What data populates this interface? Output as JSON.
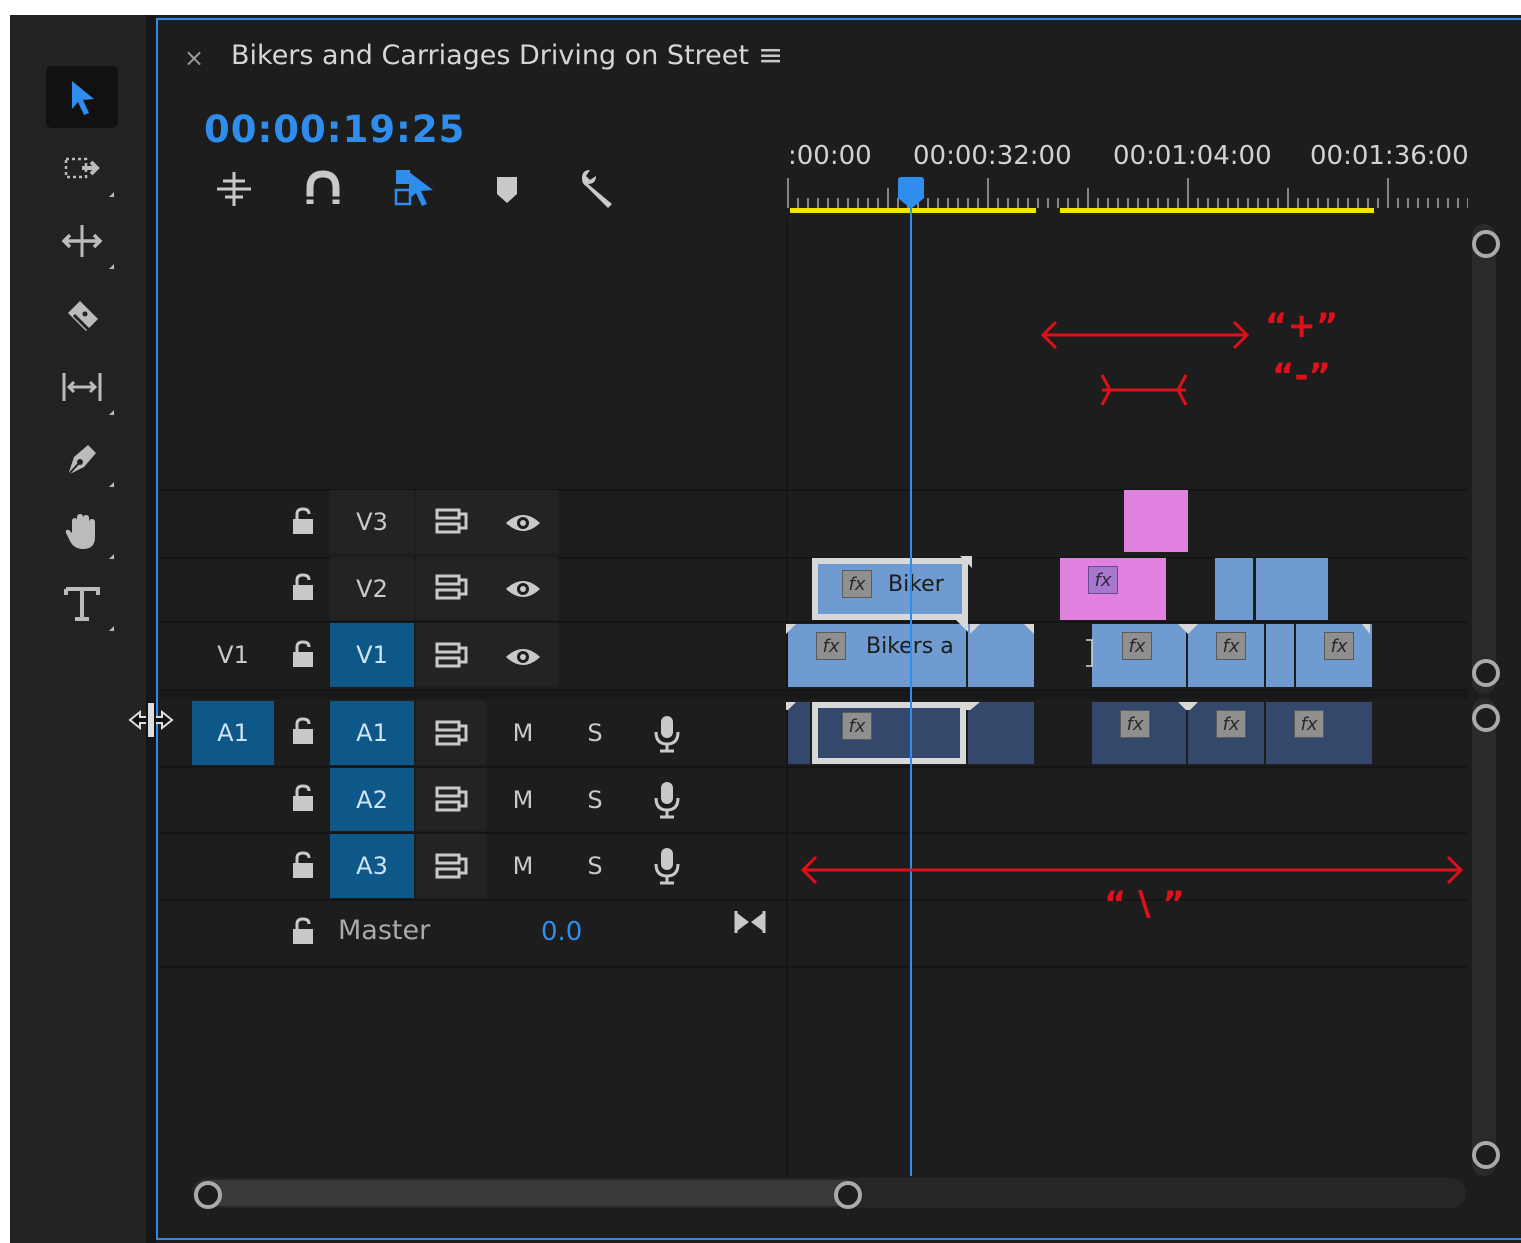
{
  "panel": {
    "close_glyph": "×",
    "sequence_title": "Bikers and Carriages Driving on Street",
    "menu_glyph": "≡"
  },
  "timecode": "00:00:19:25",
  "toolbar": {
    "tools": [
      {
        "name": "selection-tool-icon",
        "active": true
      },
      {
        "name": "track-select-forward-tool-icon",
        "active": false
      },
      {
        "name": "ripple-edit-tool-icon",
        "active": false
      },
      {
        "name": "razor-tool-icon",
        "active": false
      },
      {
        "name": "slip-tool-icon",
        "active": false
      },
      {
        "name": "pen-tool-icon",
        "active": false
      },
      {
        "name": "hand-tool-icon",
        "active": false
      },
      {
        "name": "type-tool-icon",
        "active": false
      }
    ]
  },
  "timeline_controls": [
    "insert-nest-icon",
    "snap-magnet-icon",
    "linked-selection-icon",
    "add-marker-icon",
    "timeline-settings-wrench-icon"
  ],
  "ruler": {
    "labels": [
      ":00:00",
      "00:00:32:00",
      "00:01:04:00",
      "00:01:36:00"
    ],
    "render_bar_color": "#f2e600",
    "playhead_color": "#2e8ded"
  },
  "tracks": {
    "video": [
      {
        "source": "",
        "name": "V3"
      },
      {
        "source": "",
        "name": "V2"
      },
      {
        "source": "V1",
        "name": "V1"
      }
    ],
    "audio": [
      {
        "source": "A1",
        "name": "A1",
        "mute": "M",
        "solo": "S"
      },
      {
        "source": "",
        "name": "A2",
        "mute": "M",
        "solo": "S"
      },
      {
        "source": "",
        "name": "A3",
        "mute": "M",
        "solo": "S"
      }
    ],
    "master": {
      "label": "Master",
      "value": "0.0"
    }
  },
  "clips": {
    "fx_label": "fx",
    "v2_clip_name": "Biker",
    "v1_clip_name": "Bikers a"
  },
  "annotations": {
    "zoom_in": "“+”",
    "zoom_out": "“-”",
    "fit_all": "“ \\ ”",
    "color": "#e0101a"
  }
}
